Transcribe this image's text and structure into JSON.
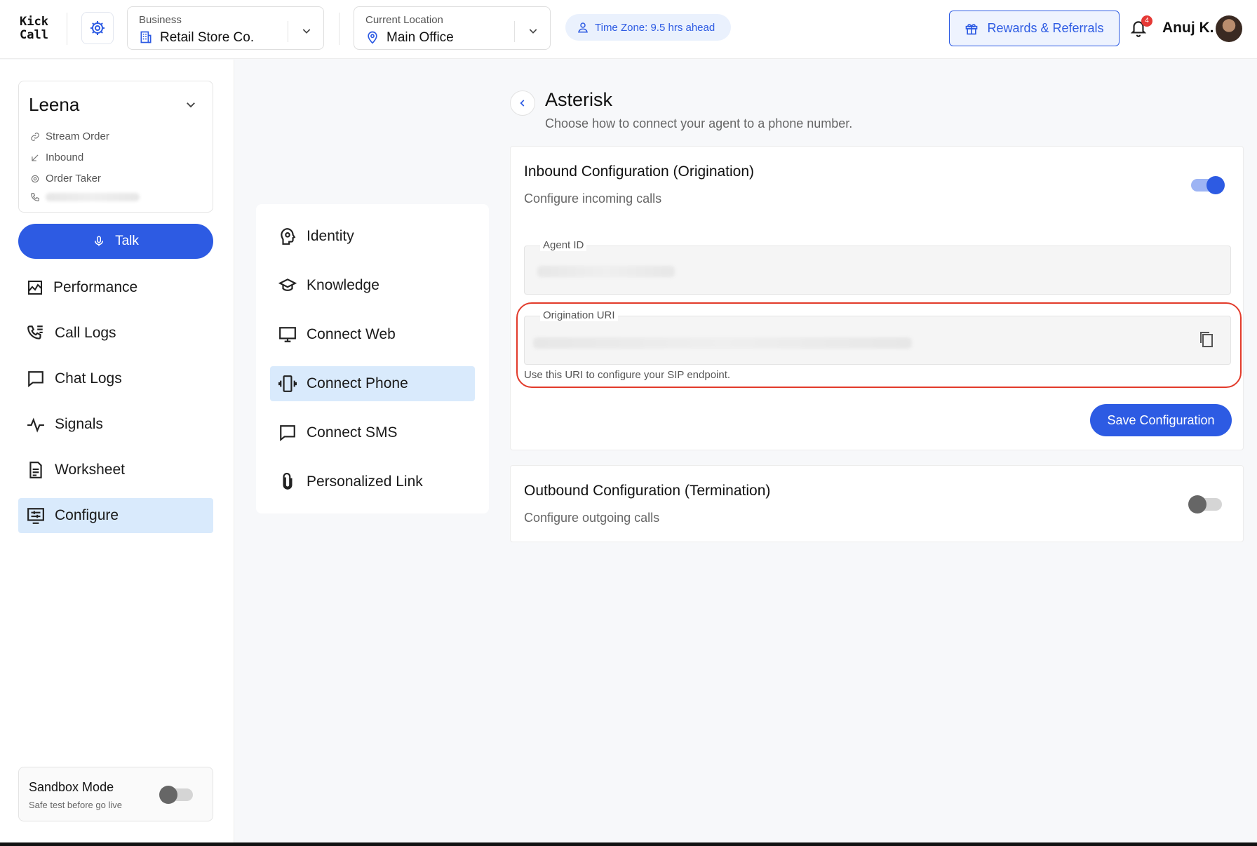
{
  "app": {
    "logo_line1": "Kick",
    "logo_line2": "Call"
  },
  "header": {
    "business": {
      "label": "Business",
      "value": "Retail Store Co."
    },
    "location": {
      "label": "Current Location",
      "value": "Main Office"
    },
    "timezone": "Time Zone: 9.5 hrs ahead",
    "rewards_label": "Rewards & Referrals",
    "notification_count": "4",
    "user_name": "Anuj K."
  },
  "agent": {
    "name": "Leena",
    "details": [
      "Stream Order",
      "Inbound",
      "Order Taker"
    ]
  },
  "sidebar": {
    "talk_label": "Talk",
    "items": [
      {
        "label": "Performance",
        "icon": "chart-icon"
      },
      {
        "label": "Call Logs",
        "icon": "phone-list-icon"
      },
      {
        "label": "Chat Logs",
        "icon": "chat-icon"
      },
      {
        "label": "Signals",
        "icon": "pulse-icon"
      },
      {
        "label": "Worksheet",
        "icon": "document-icon"
      },
      {
        "label": "Configure",
        "icon": "configure-icon",
        "active": true
      }
    ],
    "sandbox": {
      "title": "Sandbox Mode",
      "subtitle": "Safe test before go live",
      "enabled": false
    }
  },
  "subnav": {
    "items": [
      {
        "label": "Identity",
        "icon": "head-icon"
      },
      {
        "label": "Knowledge",
        "icon": "graduation-cap-icon"
      },
      {
        "label": "Connect Web",
        "icon": "monitor-icon"
      },
      {
        "label": "Connect Phone",
        "icon": "vibrating-phone-icon",
        "active": true
      },
      {
        "label": "Connect SMS",
        "icon": "message-icon"
      },
      {
        "label": "Personalized Link",
        "icon": "paperclip-icon"
      }
    ]
  },
  "main": {
    "title": "Asterisk",
    "subtitle": "Choose how to connect your agent to a phone number.",
    "inbound": {
      "title": "Inbound Configuration (Origination)",
      "subtitle": "Configure incoming calls",
      "enabled": true,
      "agent_id_label": "Agent ID",
      "origination_uri_label": "Origination URI",
      "helper": "Use this URI to configure your SIP endpoint.",
      "save_label": "Save Configuration"
    },
    "outbound": {
      "title": "Outbound Configuration (Termination)",
      "subtitle": "Configure outgoing calls",
      "enabled": false
    }
  },
  "colors": {
    "accent": "#2d5be3",
    "active_bg": "#d9eafc",
    "annotation": "#e23a2a"
  }
}
